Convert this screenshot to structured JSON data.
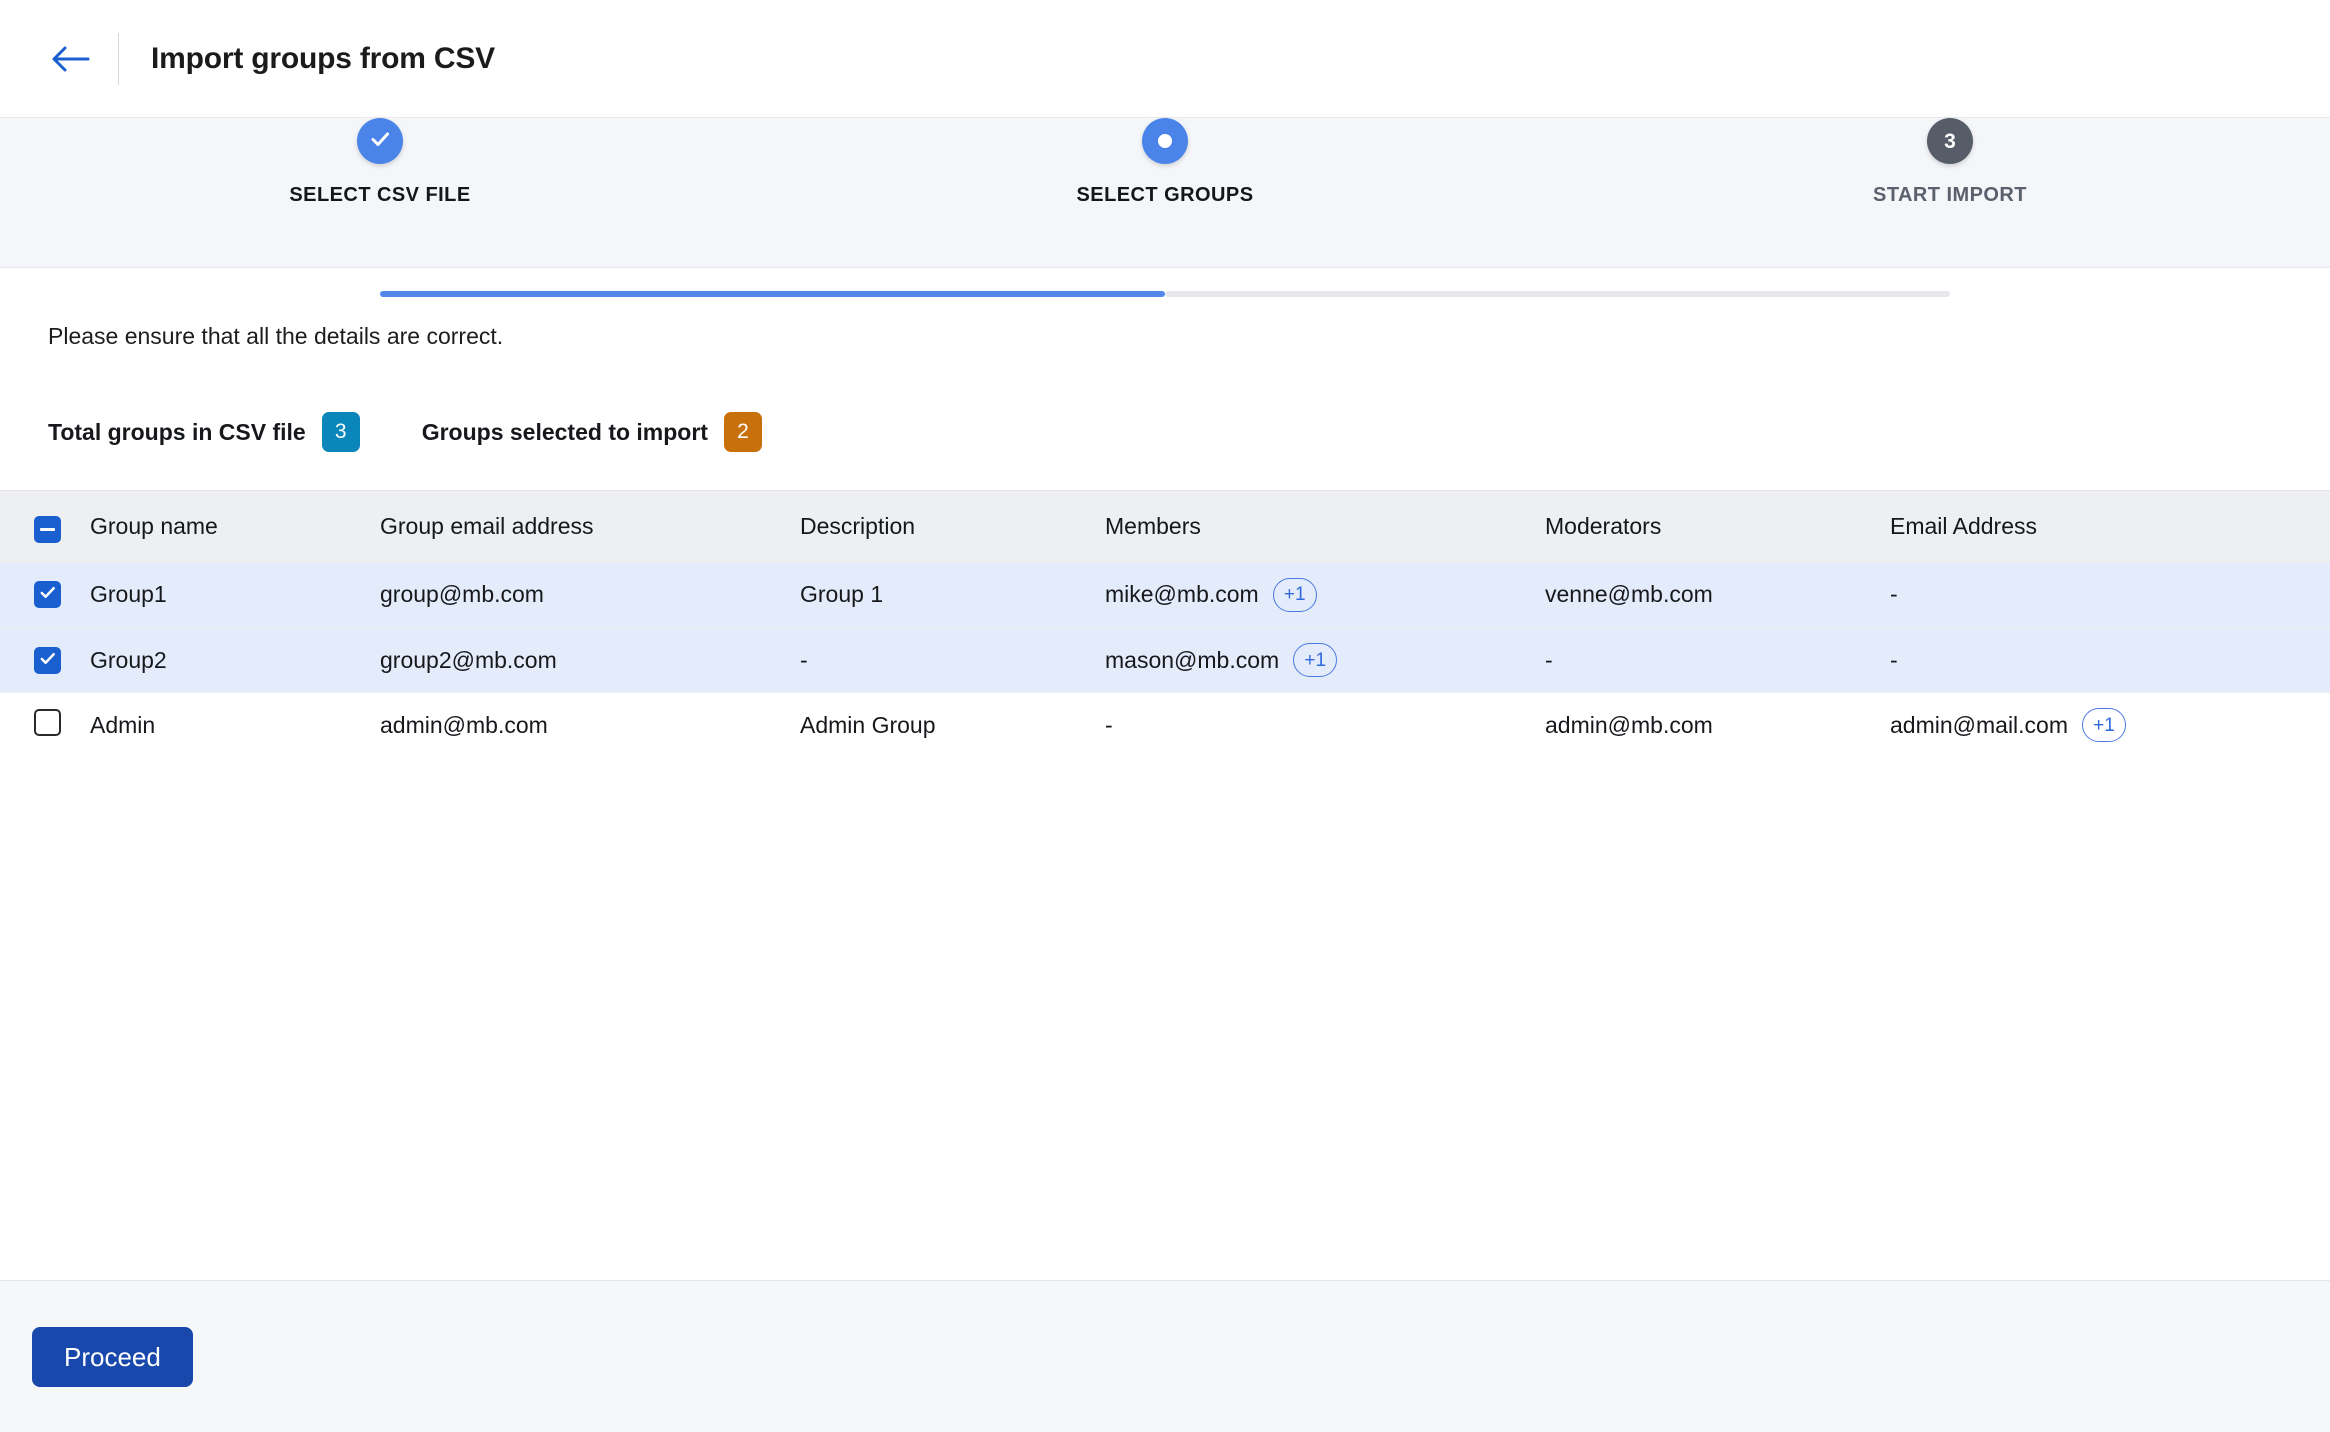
{
  "header": {
    "title": "Import groups from CSV",
    "back_icon": "arrow-left-icon"
  },
  "stepper": {
    "steps": [
      {
        "label": "SELECT CSV FILE",
        "state": "completed",
        "marker": "check-icon"
      },
      {
        "label": "SELECT GROUPS",
        "state": "current",
        "marker": "dot"
      },
      {
        "label": "START IMPORT",
        "state": "upcoming",
        "marker": "3"
      }
    ]
  },
  "main": {
    "notice": "Please ensure that all the details are correct.",
    "counts": [
      {
        "label": "Total groups in CSV file",
        "value": "3",
        "color": "#0b86ba"
      },
      {
        "label": "Groups selected to import",
        "value": "2",
        "color": "#c8700c"
      }
    ],
    "table": {
      "select_all_state": "indeterminate",
      "columns": [
        "Group name",
        "Group email address",
        "Description",
        "Members",
        "Moderators",
        "Email Address"
      ],
      "rows": [
        {
          "selected": true,
          "group_name": "Group1",
          "group_email": "group@mb.com",
          "description": "Group 1",
          "members": "mike@mb.com",
          "members_more": "+1",
          "moderators": "venne@mb.com",
          "moderators_more": "",
          "email_address": "-",
          "email_address_more": ""
        },
        {
          "selected": true,
          "group_name": "Group2",
          "group_email": "group2@mb.com",
          "description": "-",
          "members": "mason@mb.com",
          "members_more": "+1",
          "moderators": "-",
          "moderators_more": "",
          "email_address": "-",
          "email_address_more": ""
        },
        {
          "selected": false,
          "group_name": "Admin",
          "group_email": "admin@mb.com",
          "description": "Admin Group",
          "members": "-",
          "members_more": "",
          "moderators": "admin@mb.com",
          "moderators_more": "",
          "email_address": "admin@mail.com",
          "email_address_more": "+1"
        }
      ]
    }
  },
  "footer": {
    "proceed_label": "Proceed"
  },
  "colors": {
    "accent_blue": "#4a84e8",
    "primary_button": "#1848ab",
    "checkbox_blue": "#1a5fd0",
    "badge_total": "#0b86ba",
    "badge_selected": "#c8700c",
    "row_selected_bg": "#e4ecfb"
  }
}
